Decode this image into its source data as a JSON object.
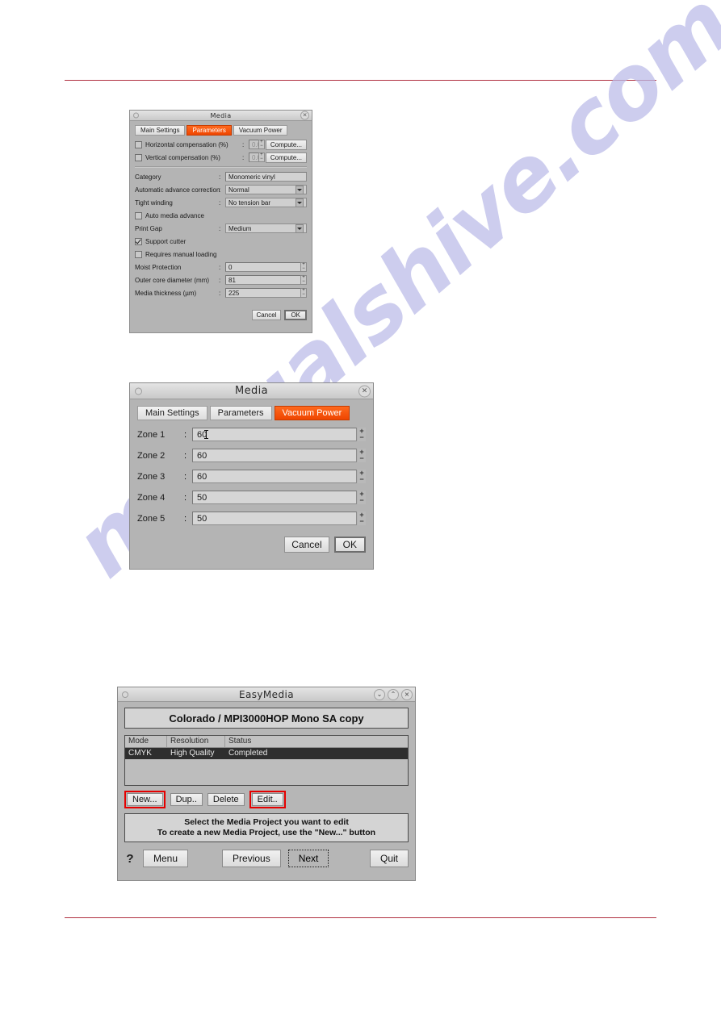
{
  "page": {
    "rule_color": "#b03040",
    "watermark_text": "manualshive.com"
  },
  "dialog_parameters": {
    "title": "Media",
    "close_icon": "×",
    "tabs": [
      {
        "label": "Main Settings",
        "active": false
      },
      {
        "label": "Parameters",
        "active": true
      },
      {
        "label": "Vacuum Power",
        "active": false
      }
    ],
    "accent_color": "#ef4f00",
    "rows": [
      {
        "type": "check-field-button",
        "label": "Horizontal compensation (%)",
        "checked": false,
        "colon": ":",
        "value": "0.00",
        "button": "Compute..."
      },
      {
        "type": "check-field-button",
        "label": "Vertical compensation (%)",
        "checked": false,
        "colon": ":",
        "value": "0.00",
        "button": "Compute..."
      }
    ],
    "category_label": "Category",
    "category_colon": ":",
    "category_value": "Monomeric vinyl",
    "advance_label": "Automatic advance correction",
    "advance_colon": ":",
    "advance_value": "Normal",
    "tight_label": "Tight winding",
    "tight_colon": ":",
    "tight_value": "No tension bar",
    "auto_media_advance": "Auto media advance",
    "print_gap_label": "Print Gap",
    "print_gap_colon": ":",
    "print_gap_value": "Medium",
    "support_cutter": "Support cutter",
    "requires_manual_loading": "Requires manual loading",
    "moist_label": "Moist Protection",
    "moist_colon": ":",
    "moist_value": "0",
    "outer_core_label": "Outer core diameter (mm)",
    "outer_core_colon": ":",
    "outer_core_value": "81",
    "thickness_label": "Media thickness (µm)",
    "thickness_colon": ":",
    "thickness_value": "225",
    "cancel_label": "Cancel",
    "ok_label": "OK"
  },
  "dialog_vacuum": {
    "title": "Media",
    "close_icon": "×",
    "tabs": [
      {
        "label": "Main Settings",
        "active": false
      },
      {
        "label": "Parameters",
        "active": false
      },
      {
        "label": "Vacuum Power",
        "active": true
      }
    ],
    "accent_color": "#ef4f00",
    "zones": [
      {
        "label": "Zone 1",
        "colon": ":",
        "value": "60",
        "focused": true
      },
      {
        "label": "Zone 2",
        "colon": ":",
        "value": "60",
        "focused": false
      },
      {
        "label": "Zone 3",
        "colon": ":",
        "value": "60",
        "focused": false
      },
      {
        "label": "Zone 4",
        "colon": ":",
        "value": "50",
        "focused": false
      },
      {
        "label": "Zone 5",
        "colon": ":",
        "value": "50",
        "focused": false
      }
    ],
    "cancel_label": "Cancel",
    "ok_label": "OK"
  },
  "dialog_easymedia": {
    "title": "EasyMedia",
    "window_buttons": [
      "⌄",
      "⌃",
      "×"
    ],
    "project_name": "Colorado / MPI3000HOP Mono SA copy",
    "table": {
      "headers": [
        "Mode",
        "Resolution",
        "Status"
      ],
      "rows": [
        {
          "mode": "CMYK",
          "resolution": "High Quality",
          "status": "Completed",
          "selected": true
        }
      ]
    },
    "actions": [
      {
        "label": "New...",
        "highlighted": true
      },
      {
        "label": "Dup..",
        "highlighted": false
      },
      {
        "label": "Delete",
        "highlighted": false
      },
      {
        "label": "Edit..",
        "highlighted": true
      }
    ],
    "highlight_color": "#e50000",
    "hint_line1": "Select the Media Project you want to edit",
    "hint_line2": "To create a new Media Project, use the \"New...\" button",
    "help_label": "?",
    "nav": [
      {
        "label": "Menu",
        "focused": false
      },
      {
        "label": "Previous",
        "focused": false
      },
      {
        "label": "Next",
        "focused": true
      },
      {
        "label": "Quit",
        "focused": false
      }
    ]
  }
}
